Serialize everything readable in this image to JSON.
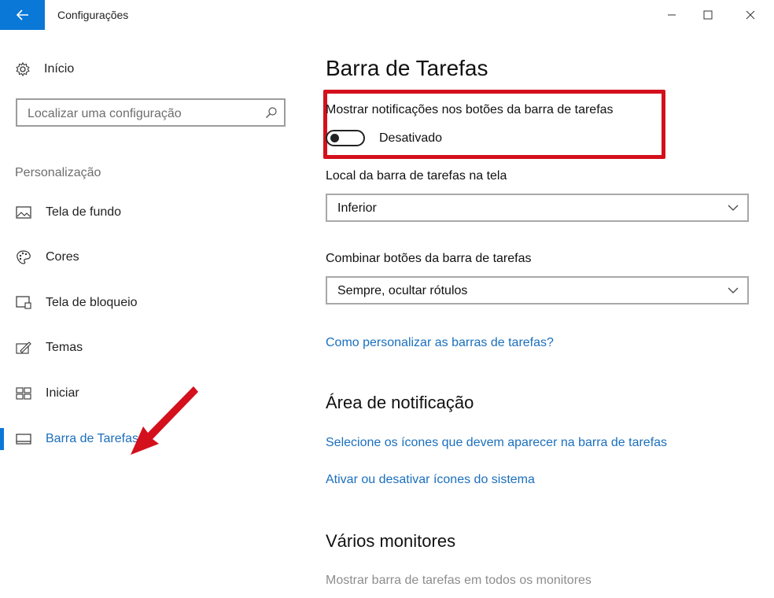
{
  "window": {
    "title": "Configurações",
    "controls": [
      "minimize-icon",
      "maximize-icon",
      "close-icon"
    ]
  },
  "sidebar": {
    "home_label": "Início",
    "search_placeholder": "Localizar uma configuração",
    "section_label": "Personalização",
    "items": [
      {
        "label": "Tela de fundo",
        "icon": "picture-icon"
      },
      {
        "label": "Cores",
        "icon": "palette-icon"
      },
      {
        "label": "Tela de bloqueio",
        "icon": "lock-screen-icon"
      },
      {
        "label": "Temas",
        "icon": "brush-icon"
      },
      {
        "label": "Iniciar",
        "icon": "start-tiles-icon"
      },
      {
        "label": "Barra de Tarefas",
        "icon": "taskbar-icon",
        "active": true
      }
    ]
  },
  "main": {
    "title": "Barra de Tarefas",
    "badges_setting": {
      "label": "Mostrar notificações nos botões da barra de tarefas",
      "toggle_on": false,
      "state_label": "Desativado"
    },
    "location_setting": {
      "label": "Local da barra de tarefas na tela",
      "value": "Inferior"
    },
    "combine_setting": {
      "label": "Combinar botões da barra de tarefas",
      "value": "Sempre, ocultar rótulos"
    },
    "help_link": "Como personalizar as barras de tarefas?",
    "notification_area": {
      "heading": "Área de notificação",
      "link1": "Selecione os ícones que devem aparecer na barra de tarefas",
      "link2": "Ativar ou desativar ícones do sistema"
    },
    "multiple_monitors": {
      "heading": "Vários monitores",
      "setting_label": "Mostrar barra de tarefas em todos os monitores"
    }
  },
  "colors": {
    "accent": "#0a78d7",
    "link": "#1b6fbd",
    "highlight": "#d3101c"
  }
}
